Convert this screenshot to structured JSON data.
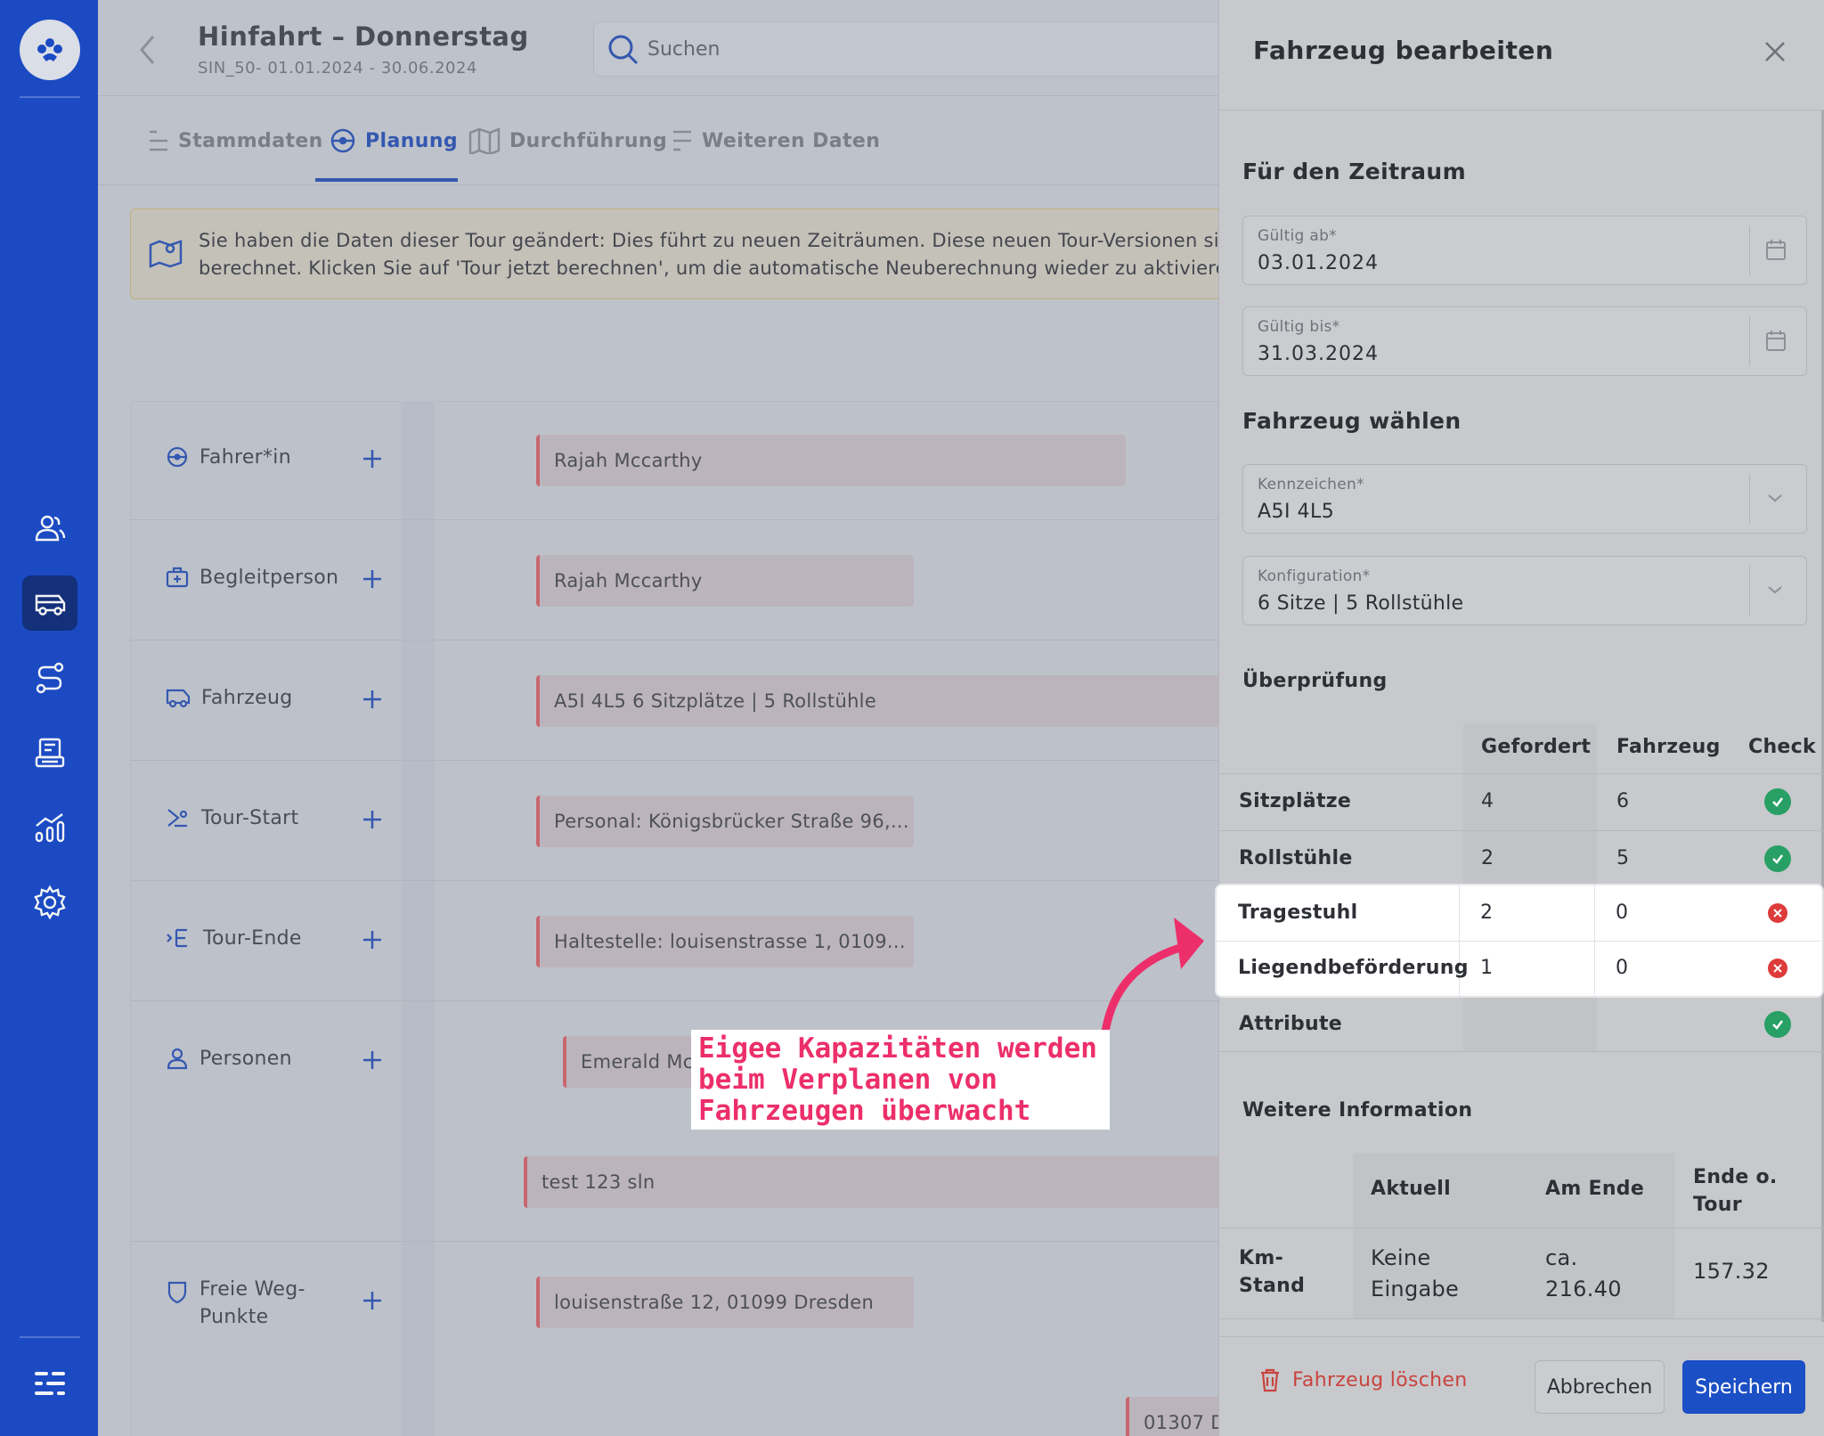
{
  "header": {
    "title": "Hinfahrt – Donnerstag",
    "subtitle": "SIN_50- 01.01.2024 - 30.06.2024",
    "search_placeholder": "Suchen"
  },
  "tabs": [
    {
      "label": "Stammdaten",
      "icon": "list-icon"
    },
    {
      "label": "Planung",
      "icon": "steering-wheel-icon",
      "active": true
    },
    {
      "label": "Durchführung",
      "icon": "map-icon"
    },
    {
      "label": "Weiteren Daten",
      "icon": "list-icon"
    }
  ],
  "notice": {
    "line1": "Sie haben die Daten dieser Tour geändert: Dies führt zu neuen Zeiträumen. Diese neuen Tour-Versionen sind",
    "line2": "berechnet. Klicken Sie auf 'Tour jetzt berechnen', um die automatische Neuberechnung wieder zu aktivieren"
  },
  "plan_rows": [
    {
      "label": "Fahrer*in",
      "icon": "steering-wheel-icon",
      "chips": [
        "Rajah Mccarthy"
      ]
    },
    {
      "label": "Begleitperson",
      "icon": "medical-bag-icon",
      "chips": [
        "Rajah Mccarthy"
      ]
    },
    {
      "label": "Fahrzeug",
      "icon": "vehicle-icon",
      "chips": [
        "A5I 4L5 6 Sitzplätze | 5 Rollstühle"
      ]
    },
    {
      "label": "Tour-Start",
      "icon": "tour-start-icon",
      "chips": [
        "Personal: Königsbrücker Straße 96,..."
      ]
    },
    {
      "label": "Tour-Ende",
      "icon": "tour-end-icon",
      "chips": [
        "Haltestelle: louisenstrasse 1, 0109..."
      ]
    },
    {
      "label": "Personen",
      "icon": "person-icon",
      "chips": [
        "Emerald Mc",
        "test 123 sln"
      ]
    },
    {
      "label": "Freie Weg-",
      "label2": "Punkte",
      "icon": "shield-icon",
      "chips": [
        "louisenstraße 12, 01099 Dresden",
        "01307 D"
      ]
    }
  ],
  "drawer": {
    "title": "Fahrzeug bearbeiten",
    "section_period": "Für den Zeitraum",
    "valid_from_label": "Gültig ab*",
    "valid_from_value": "03.01.2024",
    "valid_to_label": "Gültig bis*",
    "valid_to_value": "31.03.2024",
    "section_vehicle": "Fahrzeug wählen",
    "plate_label": "Kennzeichen*",
    "plate_value": "A5I 4L5",
    "config_label": "Konfiguration*",
    "config_value": "6 Sitze | 5 Rollstühle",
    "section_check": "Überprüfung",
    "check_headers": {
      "required": "Gefordert",
      "vehicle": "Fahrzeug",
      "check": "Check"
    },
    "check_rows": [
      {
        "name": "Sitzplätze",
        "required": "4",
        "vehicle": "6",
        "ok": true
      },
      {
        "name": "Rollstühle",
        "required": "2",
        "vehicle": "5",
        "ok": true
      },
      {
        "name": "Tragestuhl",
        "required": "2",
        "vehicle": "0",
        "ok": false
      },
      {
        "name": "Liegendbeförderung",
        "required": "1",
        "vehicle": "0",
        "ok": false
      },
      {
        "name": "Attribute",
        "required": "",
        "vehicle": "",
        "ok": true
      }
    ],
    "section_info": "Weitere Information",
    "info_headers": {
      "current": "Aktuell",
      "end": "Am Ende",
      "tour_end_1": "Ende o.",
      "tour_end_2": "Tour"
    },
    "info_row": {
      "name_1": "Km-",
      "name_2": "Stand",
      "current_1": "Keine",
      "current_2": "Eingabe",
      "end_1": "ca.",
      "end_2": "216.40",
      "tour_end": "157.32"
    },
    "delete_label": "Fahrzeug löschen",
    "cancel_label": "Abbrechen",
    "save_label": "Speichern"
  },
  "annotation": {
    "text": "Eigee Kapazitäten werden\nbeim Verplanen von\nFahrzeugen überwacht",
    "color": "#ec2f6b"
  },
  "colors": {
    "sidebar": "#1446c8",
    "accent": "#2f55b3",
    "save_button": "#1b4fc5",
    "ok": "#28a065",
    "fail": "#de3b3b",
    "chip_border": "#d0656d"
  }
}
